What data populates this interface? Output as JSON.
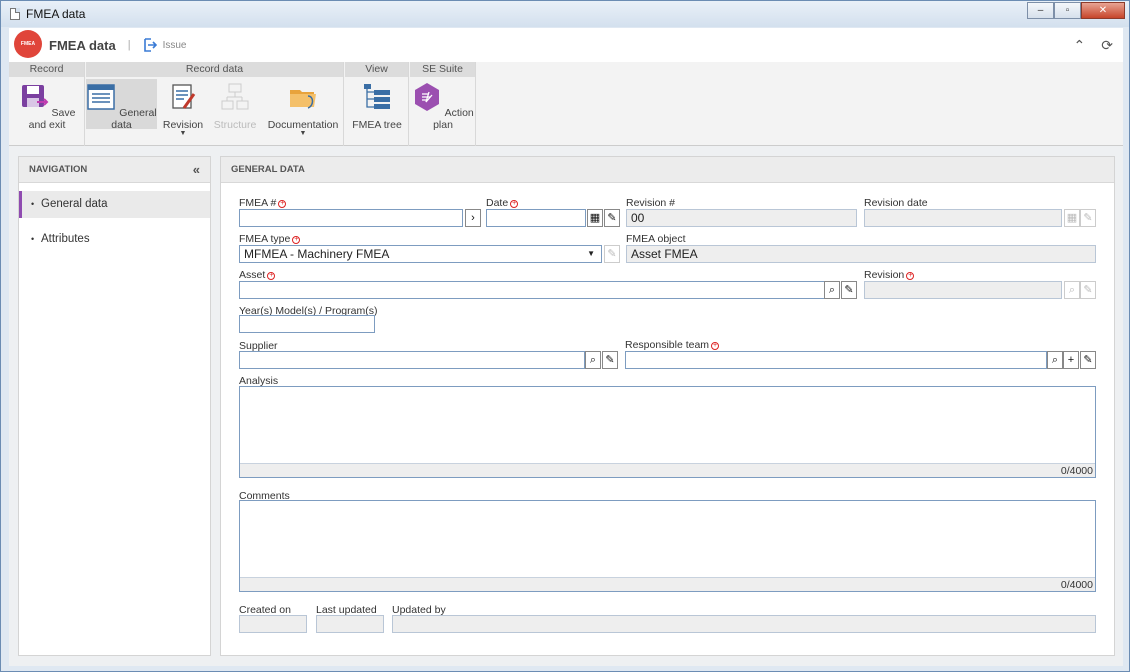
{
  "window": {
    "title": "FMEA data"
  },
  "header": {
    "app_title": "FMEA data",
    "logo_text": "FMEA",
    "issue_label": "Issue"
  },
  "ribbon": {
    "groups": [
      "Record",
      "Record data",
      "View",
      "SE Suite"
    ],
    "buttons": {
      "save_exit": "Save and exit",
      "general_data": "General data",
      "revision": "Revision",
      "structure": "Structure",
      "documentation": "Documentation",
      "fmea_tree": "FMEA tree",
      "action_plan": "Action plan"
    }
  },
  "navigation": {
    "title": "NAVIGATION",
    "items": [
      "General data",
      "Attributes"
    ]
  },
  "main": {
    "title": "GENERAL DATA",
    "fields": {
      "fmea_no": {
        "label": "FMEA #",
        "value": ""
      },
      "date": {
        "label": "Date",
        "value": ""
      },
      "revision_no": {
        "label": "Revision #",
        "value": "00"
      },
      "revision_date": {
        "label": "Revision date",
        "value": ""
      },
      "fmea_type": {
        "label": "FMEA type",
        "value": "MFMEA - Machinery FMEA"
      },
      "fmea_object": {
        "label": "FMEA object",
        "value": "Asset FMEA"
      },
      "asset": {
        "label": "Asset",
        "value": ""
      },
      "revision": {
        "label": "Revision",
        "value": ""
      },
      "years_models": {
        "label": "Year(s) Model(s) / Program(s)",
        "value": ""
      },
      "supplier": {
        "label": "Supplier",
        "value": ""
      },
      "responsible_team": {
        "label": "Responsible team",
        "value": ""
      },
      "analysis": {
        "label": "Analysis",
        "counter": "0/4000"
      },
      "comments": {
        "label": "Comments",
        "counter": "0/4000"
      },
      "created_on": {
        "label": "Created on",
        "value": ""
      },
      "last_updated": {
        "label": "Last updated",
        "value": ""
      },
      "updated_by": {
        "label": "Updated by",
        "value": ""
      }
    }
  },
  "colors": {
    "accent": "#8f4bb0",
    "logo": "#e0453a",
    "required": "#dd2222",
    "input_border": "#7d9cc0"
  }
}
